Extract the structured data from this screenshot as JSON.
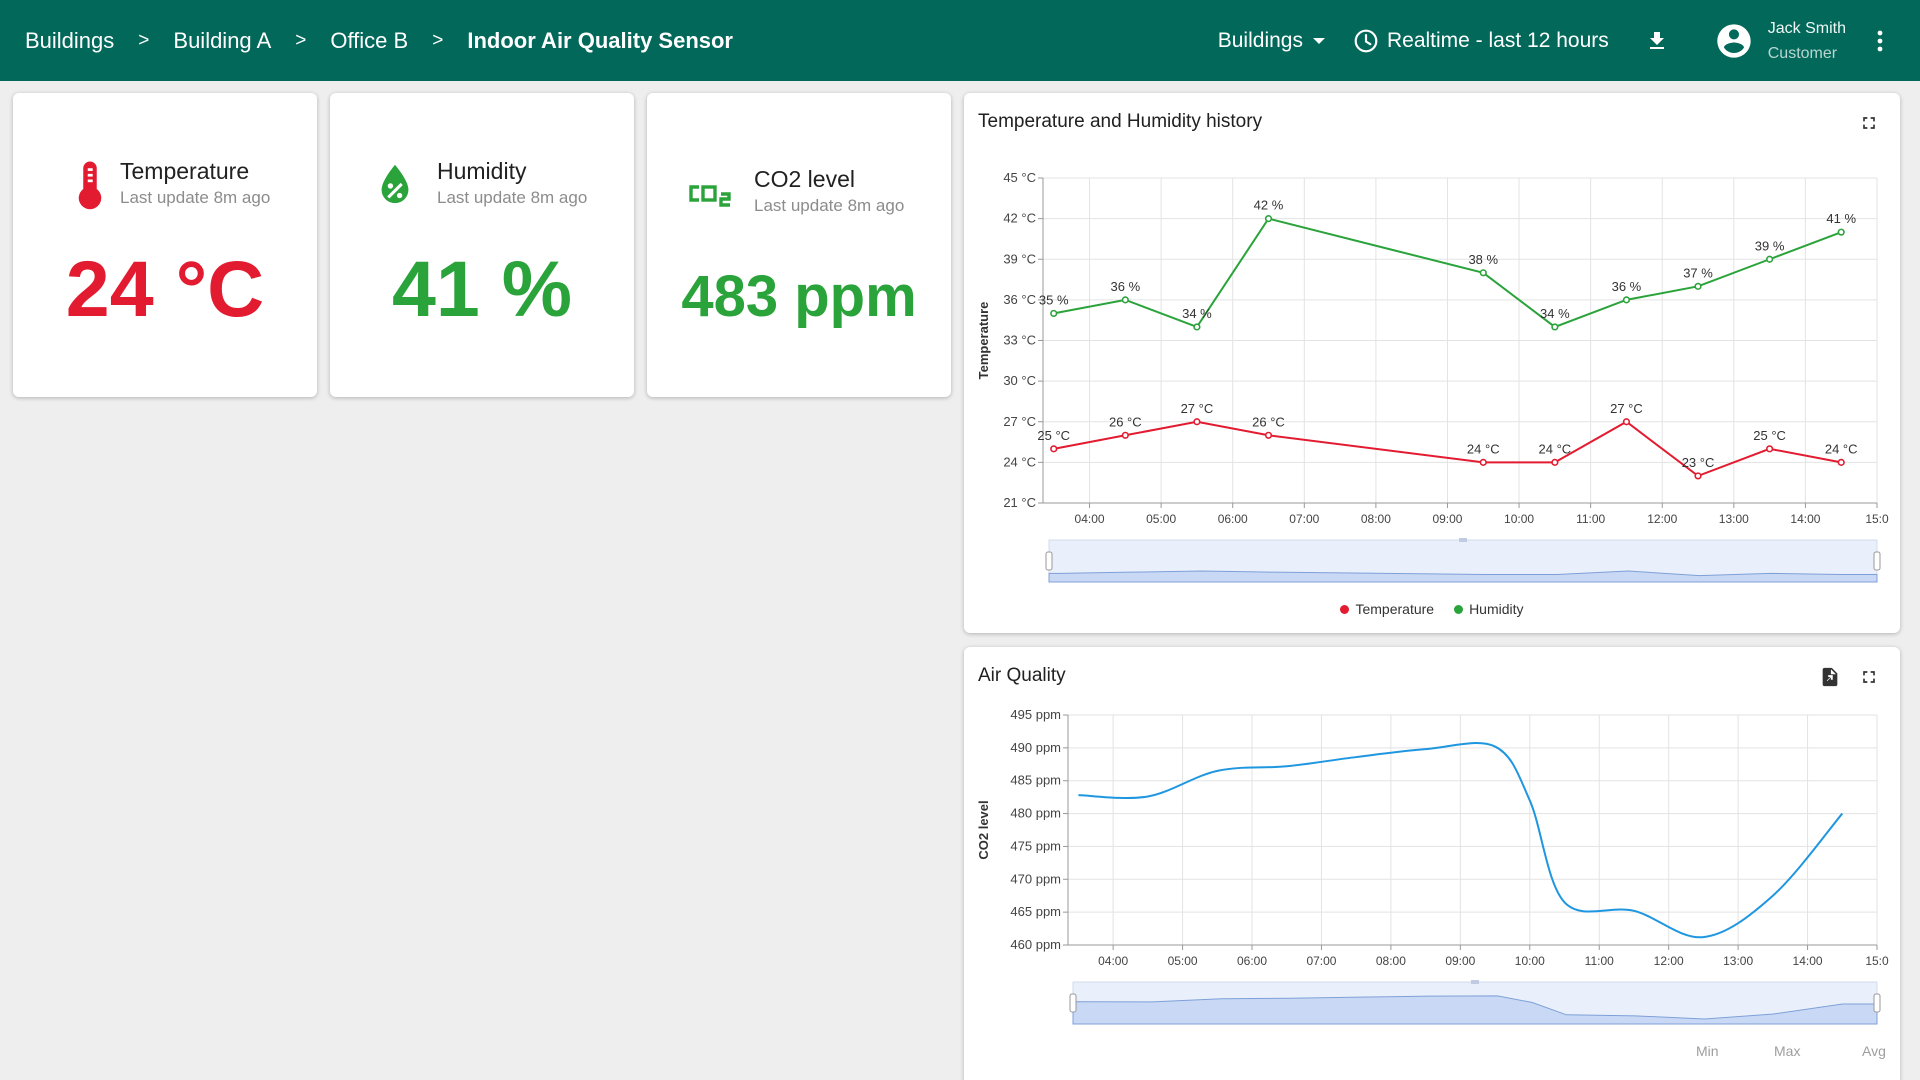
{
  "header": {
    "breadcrumb": [
      "Buildings",
      "Building A",
      "Office B",
      "Indoor Air Quality Sensor"
    ],
    "separator": ">",
    "dashboard_select": "Buildings",
    "timewindow": "Realtime - last 12 hours",
    "user_name": "Jack Smith",
    "user_role": "Customer"
  },
  "colors": {
    "header": "#02685a",
    "temperature": "#e31b30",
    "humidity": "#2aa33a",
    "co2": "#2aa33a",
    "co2_line": "#1f96e0"
  },
  "cards": [
    {
      "title": "Temperature",
      "subtitle": "Last update 8m ago",
      "value": "24 °C",
      "icon": "thermometer-icon"
    },
    {
      "title": "Humidity",
      "subtitle": "Last update 8m ago",
      "value": "41 %",
      "icon": "water-percent-icon"
    },
    {
      "title": "CO2 level",
      "subtitle": "Last update 8m ago",
      "value": "483 ppm",
      "icon": "co2-icon"
    }
  ],
  "history_widget": {
    "title": "Temperature and Humidity history"
  },
  "air_widget": {
    "title": "Air Quality"
  },
  "chart_data": [
    {
      "type": "line",
      "title": "Temperature and Humidity history",
      "ylabel": "Temperature",
      "ylim": [
        21,
        45
      ],
      "yticks": [
        "21 °C",
        "24 °C",
        "27 °C",
        "30 °C",
        "33 °C",
        "36 °C",
        "39 °C",
        "42 °C",
        "45 °C"
      ],
      "xticks": [
        "04:00",
        "05:00",
        "06:00",
        "07:00",
        "08:00",
        "09:00",
        "10:00",
        "11:00",
        "12:00",
        "13:00",
        "14:00",
        "15:0"
      ],
      "x": [
        "03:30",
        "04:30",
        "05:30",
        "06:30",
        "09:30",
        "10:30",
        "11:30",
        "12:30",
        "13:30",
        "14:30"
      ],
      "grid": true,
      "legend": "bottom-center",
      "series": [
        {
          "name": "Temperature",
          "values": [
            25,
            26,
            27,
            26,
            24,
            24,
            27,
            23,
            25,
            24
          ],
          "labels": [
            "25 °C",
            "26 °C",
            "27 °C",
            "26 °C",
            "24 °C",
            "24 °C",
            "27 °C",
            "23 °C",
            "25 °C",
            "24 °C"
          ]
        },
        {
          "name": "Humidity",
          "values": [
            35,
            36,
            34,
            42,
            38,
            34,
            36,
            37,
            39,
            41
          ],
          "labels": [
            "35 %",
            "36 %",
            "34 %",
            "42 %",
            "38 %",
            "34 %",
            "36 %",
            "37 %",
            "39 %",
            "41 %"
          ]
        }
      ]
    },
    {
      "type": "line",
      "title": "Air Quality",
      "ylabel": "CO2 level",
      "ylim": [
        460,
        495
      ],
      "yticks": [
        "460 ppm",
        "465 ppm",
        "470 ppm",
        "475 ppm",
        "480 ppm",
        "485 ppm",
        "490 ppm",
        "495 ppm"
      ],
      "xticks": [
        "04:00",
        "05:00",
        "06:00",
        "07:00",
        "08:00",
        "09:00",
        "10:00",
        "11:00",
        "12:00",
        "13:00",
        "14:00",
        "15:0"
      ],
      "x": [
        "03:30",
        "04:30",
        "05:30",
        "06:30",
        "07:30",
        "08:30",
        "09:30",
        "10:00",
        "10:30",
        "11:30",
        "12:30",
        "13:30",
        "14:30"
      ],
      "grid": true,
      "series": [
        {
          "name": "CO2 level",
          "values": [
            482.8,
            482.6,
            486.5,
            487.2,
            488.6,
            489.8,
            490.2,
            482,
            466.5,
            465.2,
            461.2,
            467.5,
            480
          ]
        }
      ],
      "stats_headers": [
        "Min",
        "Max",
        "Avg"
      ]
    }
  ]
}
